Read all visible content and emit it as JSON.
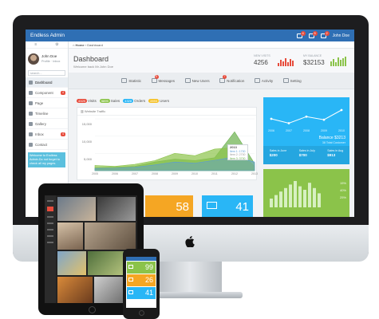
{
  "app": {
    "brand": "Endless Admin",
    "user_top": "John Doe"
  },
  "topbar_badges": [
    "4",
    "5",
    "2"
  ],
  "sidebar": {
    "user_name": "John Doe",
    "user_status": "Profile · Inbox",
    "search_placeholder": "search...",
    "items": [
      {
        "label": "Dashboard",
        "badge": ""
      },
      {
        "label": "Component",
        "badge": "4"
      },
      {
        "label": "Page",
        "badge": ""
      },
      {
        "label": "Timeline",
        "badge": ""
      },
      {
        "label": "Gallery",
        "badge": ""
      },
      {
        "label": "Inbox",
        "badge": "4"
      },
      {
        "label": "Contact",
        "badge": ""
      }
    ],
    "note": "Welcome to Endless Admin.Do not forget to check all my pages."
  },
  "breadcrumb": {
    "home": "Home",
    "current": "Dashboard"
  },
  "header": {
    "title": "Dashboard",
    "subtitle": "Welcome back Mr.John Doe",
    "stats": [
      {
        "label": "NEW VISITS",
        "value": "4256"
      },
      {
        "label": "MY BALANCE",
        "value": "$32153"
      }
    ]
  },
  "shortcuts": [
    {
      "label": "Statistic",
      "badge": ""
    },
    {
      "label": "Messages",
      "badge": "5"
    },
    {
      "label": "New Users",
      "badge": ""
    },
    {
      "label": "Notification",
      "badge": "7"
    },
    {
      "label": "Activity",
      "badge": ""
    },
    {
      "label": "Setting",
      "badge": ""
    }
  ],
  "summary_tabs": [
    {
      "count": "4325",
      "label": "Visits",
      "color": "#e74c3c"
    },
    {
      "count": "5895",
      "label": "Sales",
      "color": "#8bc34a"
    },
    {
      "count": "4328",
      "label": "Orders",
      "color": "#29b6f6"
    },
    {
      "count": "2893",
      "label": "Users",
      "color": "#f5c023"
    }
  ],
  "traffic_chart": {
    "title": "Website Traffic",
    "chart_data": {
      "type": "area",
      "x": [
        "2005",
        "2006",
        "2007",
        "2008",
        "2009",
        "2010",
        "2011",
        "2012",
        "2013"
      ],
      "ylim": [
        0,
        18000
      ],
      "yticks": [
        "15,000",
        "10,000",
        "5,000"
      ],
      "series": [
        {
          "name": "Item 1",
          "values": [
            1800,
            1500,
            2200,
            3500,
            6000,
            5200,
            7500,
            8000,
            1500
          ],
          "color": "#8bc34a"
        },
        {
          "name": "Item 2",
          "values": [
            1000,
            1200,
            1500,
            3000,
            4000,
            3500,
            4500,
            13500,
            2500
          ],
          "color": "#6ab04c"
        },
        {
          "name": "Item 3",
          "values": [
            800,
            900,
            1200,
            2000,
            3000,
            2600,
            3600,
            4800,
            3000
          ],
          "color": "#5a9bd5"
        }
      ]
    },
    "tooltip": {
      "year": "2013",
      "item1": "Item 1: 1700",
      "item2": "Item 2: 2700",
      "item3": "Item 3: 3700"
    }
  },
  "tiles": [
    {
      "value": "58",
      "color": "#f5a623"
    },
    {
      "value": "41",
      "color": "#29b6f6"
    }
  ],
  "balance_widget": {
    "chart_data": {
      "type": "line",
      "x": [
        "2006",
        "2007",
        "2008",
        "2009",
        "2010"
      ],
      "values": [
        40,
        30,
        45,
        38,
        60
      ],
      "color": "#ffffff"
    },
    "balance_label": "Balance $3213",
    "balance_sub": "38 Total Customer",
    "footer": [
      {
        "label": "Sales in June",
        "value": "$200"
      },
      {
        "label": "Sales in July",
        "value": "$700"
      },
      {
        "label": "Sales in Aug",
        "value": "$913"
      }
    ]
  },
  "bar_widget": {
    "chart_data": {
      "type": "bar",
      "values": [
        5,
        7,
        9,
        11,
        13,
        15,
        12,
        10,
        14,
        11,
        8
      ],
      "color": "#d7f0c1"
    },
    "labels": [
      "15%",
      "40%",
      "25%"
    ]
  },
  "phone_tiles": [
    {
      "value": "99",
      "color": "#8bc34a"
    },
    {
      "value": "26",
      "color": "#f5a623"
    },
    {
      "value": "41",
      "color": "#29b6f6"
    }
  ]
}
